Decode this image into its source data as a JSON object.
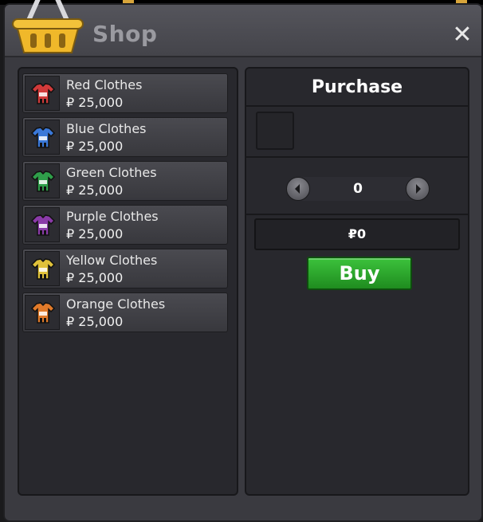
{
  "window": {
    "title": "Shop",
    "close_label": "✕"
  },
  "colors": {
    "red": "#d13a3a",
    "blue": "#3a78d8",
    "green": "#2f9e4a",
    "purple": "#8a3aa8",
    "yellow": "#e0c23a",
    "orange": "#e07a2a",
    "buy_green": "#2aa62a"
  },
  "items": [
    {
      "name": "Red Clothes",
      "price": "₽ 25,000",
      "color": "#d13a3a",
      "icon": "shirt-icon"
    },
    {
      "name": "Blue Clothes",
      "price": "₽ 25,000",
      "color": "#3a78d8",
      "icon": "shirt-icon"
    },
    {
      "name": "Green Clothes",
      "price": "₽ 25,000",
      "color": "#2f9e4a",
      "icon": "shirt-icon"
    },
    {
      "name": "Purple Clothes",
      "price": "₽ 25,000",
      "color": "#8a3aa8",
      "icon": "shirt-icon"
    },
    {
      "name": "Yellow Clothes",
      "price": "₽ 25,000",
      "color": "#e0c23a",
      "icon": "shirt-icon"
    },
    {
      "name": "Orange Clothes",
      "price": "₽ 25,000",
      "color": "#e07a2a",
      "icon": "shirt-icon"
    }
  ],
  "purchase": {
    "header": "Purchase",
    "quantity": "0",
    "total": "₽0",
    "buy_label": "Buy"
  }
}
